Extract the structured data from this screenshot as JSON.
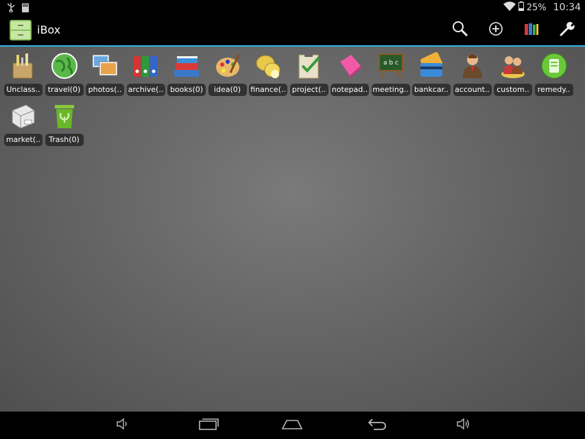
{
  "status_bar": {
    "battery": "25%",
    "time": "10:34",
    "left_icons": [
      "usb-icon",
      "sd-card-icon"
    ],
    "right_icons": [
      "wifi-icon",
      "battery-icon"
    ]
  },
  "action_bar": {
    "title": "iBox",
    "accent": "#33b5e5",
    "actions": [
      "search-icon",
      "add-icon",
      "archive-books-icon",
      "settings-wrench-icon"
    ]
  },
  "folders": [
    {
      "label": "Unclass..",
      "icon": "unclassified-icon"
    },
    {
      "label": "travel(0)",
      "icon": "globe-icon"
    },
    {
      "label": "photos(..",
      "icon": "photos-icon"
    },
    {
      "label": "archive(..",
      "icon": "binders-icon"
    },
    {
      "label": "books(0)",
      "icon": "books-icon"
    },
    {
      "label": "idea(0)",
      "icon": "palette-icon"
    },
    {
      "label": "finance(..",
      "icon": "coins-icon"
    },
    {
      "label": "project(..",
      "icon": "clipboard-icon"
    },
    {
      "label": "notepad..",
      "icon": "notepad-icon"
    },
    {
      "label": "meeting..",
      "icon": "chalkboard-icon"
    },
    {
      "label": "bankcar..",
      "icon": "bankcard-icon"
    },
    {
      "label": "account..",
      "icon": "person-icon"
    },
    {
      "label": "custom..",
      "icon": "customers-icon"
    },
    {
      "label": "remedy..",
      "icon": "remedy-icon"
    },
    {
      "label": "market(..",
      "icon": "printer-icon"
    },
    {
      "label": "Trash(0)",
      "icon": "trash-icon"
    }
  ],
  "nav_bar": {
    "buttons": [
      "volume-down-icon",
      "recents-icon",
      "home-icon",
      "back-icon",
      "volume-up-icon"
    ]
  }
}
